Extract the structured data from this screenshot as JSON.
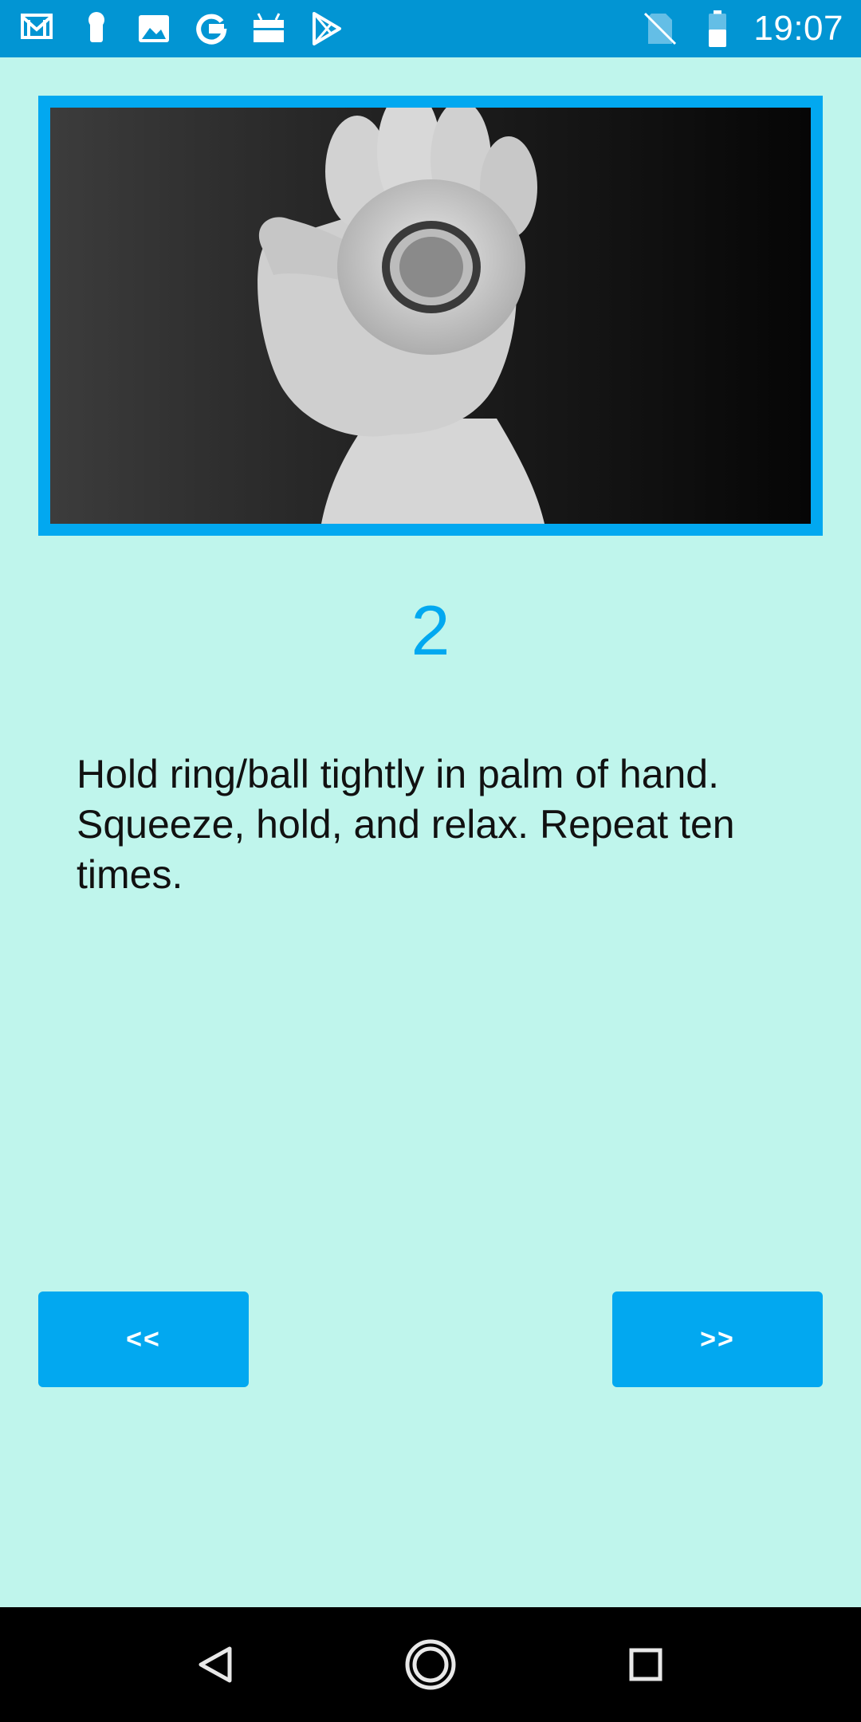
{
  "status_bar": {
    "time": "19:07",
    "left_icons": [
      "gmail-icon",
      "keyhole-icon",
      "image-icon",
      "google-icon",
      "android-icon",
      "play-store-icon"
    ],
    "right_icons": [
      "no-sim-icon",
      "battery-icon"
    ],
    "background_color": "#0295d3"
  },
  "exercise": {
    "image_icon": "hand-squeezing-ring-photo",
    "step_number": "2",
    "instruction": "Hold ring/ball tightly in palm of hand. Squeeze, hold, and relax. Repeat ten times."
  },
  "navigation": {
    "prev_label": "<<",
    "next_label": ">>"
  },
  "system_nav": {
    "icons": [
      "back-icon",
      "home-icon",
      "recents-icon"
    ]
  },
  "colors": {
    "background": "#bff5ec",
    "accent": "#02a8f0",
    "text": "#111111"
  }
}
